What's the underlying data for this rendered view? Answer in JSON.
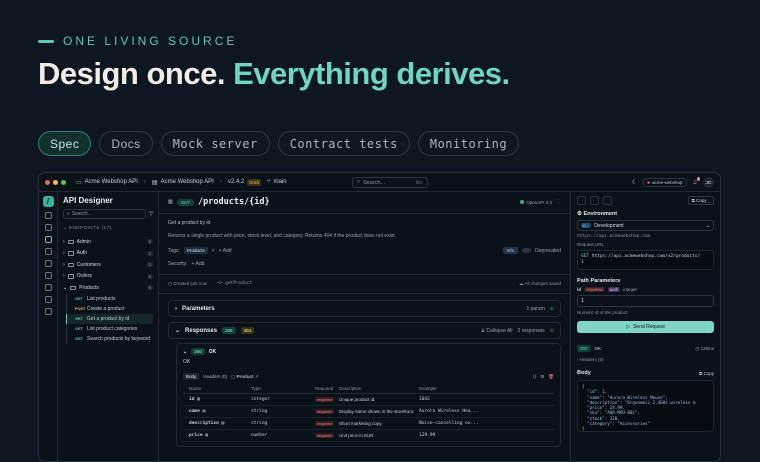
{
  "hero": {
    "eyebrow": "ONE LIVING SOURCE",
    "title_main": "Design once.",
    "title_accent": "Everything derives."
  },
  "pills": [
    {
      "label": "Spec",
      "active": true
    },
    {
      "label": "Docs",
      "active": false
    },
    {
      "label": "Mock server",
      "active": false
    },
    {
      "label": "Contract tests",
      "active": false
    },
    {
      "label": "Monitoring",
      "active": false
    }
  ],
  "topbar": {
    "workspace": "Acme Webshop API",
    "project": "Acme Webshop API",
    "version": "v2.4.2",
    "version_badge": "Draft",
    "branch": "main",
    "search_placeholder": "Search...",
    "search_shortcut": "⌘K",
    "org": "acme-webshop",
    "notif_count": "3",
    "user_initials": "JG"
  },
  "sidebar": {
    "title": "API Designer",
    "search_placeholder": "Search...",
    "section": "ENDPOINTS",
    "section_count": "(17)",
    "folders": [
      {
        "label": "Admin",
        "count": "3"
      },
      {
        "label": "Auth",
        "count": "2"
      },
      {
        "label": "Customers",
        "count": "2"
      },
      {
        "label": "Orders",
        "count": "4"
      }
    ],
    "open_folder": {
      "label": "Products",
      "count": "5"
    },
    "endpoints": [
      {
        "method": "GET",
        "label": "List products",
        "active": false
      },
      {
        "method": "POST",
        "label": "Create a product",
        "active": false
      },
      {
        "method": "GET",
        "label": "Get a product by id",
        "active": true
      },
      {
        "method": "GET",
        "label": "List product categories",
        "active": false
      },
      {
        "method": "GET",
        "label": "Search products by keyword",
        "active": false
      }
    ]
  },
  "main": {
    "method": "GET",
    "path": "/products/{id}",
    "openapi": "OpenAPI 3.0",
    "summary": "Get a product by id",
    "description": "Returns a single product with price, stock level, and category. Returns 404 if the product does not exist.",
    "tags_label": "Tags:",
    "tag": "Products",
    "add_label": "Add",
    "info_label": "Info",
    "deprecated_label": "Deprecated",
    "security_label": "Security:",
    "created": "Created just now",
    "operation_id": "getProduct",
    "saved": "All changes saved",
    "parameters_label": "Parameters",
    "parameters_count": "1 param",
    "responses_label": "Responses",
    "responses_codes": [
      "200",
      "404"
    ],
    "collapse_all": "Collapse All",
    "responses_count": "2 responses",
    "response_code": "200",
    "response_text": "OK",
    "response_desc": "OK",
    "subtabs": [
      "Body",
      "Headers (0)",
      "Product"
    ],
    "columns": [
      "Name",
      "Type",
      "Required",
      "Description",
      "Example"
    ],
    "rows": [
      {
        "name": "id",
        "type": "integer",
        "required": "required",
        "description": "Unique product id.",
        "example": "1042"
      },
      {
        "name": "name",
        "type": "string",
        "required": "required",
        "description": "Display name shown in the storefront.",
        "example": "Aurora Wireless Hea..."
      },
      {
        "name": "description",
        "type": "string",
        "required": "required",
        "description": "Short marketing copy.",
        "example": "Noise-cancelling ov..."
      },
      {
        "name": "price",
        "type": "number",
        "required": "required",
        "description": "Unit price in EUR.",
        "example": "129.99"
      }
    ]
  },
  "right": {
    "copy_label": "Copy",
    "environment_label": "Environment",
    "env_code": "D...",
    "env_name": "Development",
    "env_url": "https://api.acmewebshop.com",
    "request_url_label": "Request URL",
    "request_url": "https://api.acmewebshop.com/v2/products/",
    "request_url_2": "1",
    "request_method": "GET",
    "path_params_label": "Path Parameters",
    "param_name": "id",
    "param_required": "required",
    "param_in": "path",
    "param_type": "integer",
    "param_value": "1",
    "param_hint": "Numeric id of the product.",
    "send_label": "Send Request",
    "status_code": "200",
    "status_text": "OK",
    "status_time": "128ms",
    "headers_label": "Headers (6)",
    "body_label": "Body",
    "body_copy": "Copy",
    "json_lines": [
      "{",
      "  \"id\": 1,",
      "  \"name\": \"Aurora Wireless Mouse\",",
      "  \"description\": \"Ergonomic 2.4GHz wireless m",
      "  \"price\": 24.99,",
      "  \"sku\": \"AUR-MOU-001\",",
      "  \"stock\": 320,",
      "  \"category\": \"Accessories\"",
      "}"
    ]
  },
  "colors": {
    "accent": "#6fd6c0",
    "background": "#0e1621",
    "title": "#f1ede4"
  }
}
